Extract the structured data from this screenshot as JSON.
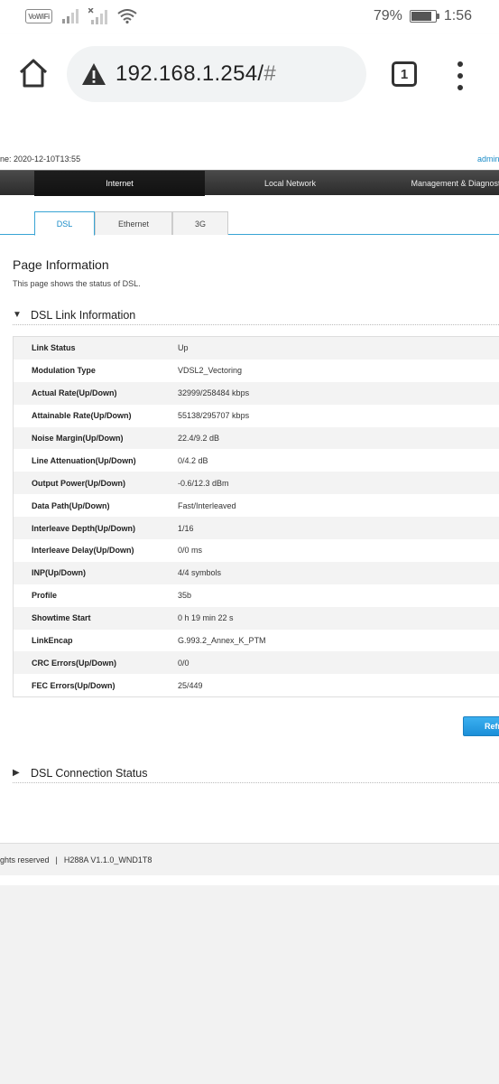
{
  "status_bar": {
    "vowifi": "VoWiFi",
    "battery_percent": "79%",
    "battery_level": 0.79,
    "time": "1:56"
  },
  "browser": {
    "url_host": "192.168.1.254/",
    "url_hash": "#",
    "tab_count": "1"
  },
  "header": {
    "time_text": "ne: 2020-12-10T13:55",
    "user_text": "admin"
  },
  "nav": {
    "items": [
      {
        "label": "Internet"
      },
      {
        "label": "Local Network"
      },
      {
        "label": "Management & Diagnostics"
      }
    ]
  },
  "subtabs": [
    {
      "label": "DSL"
    },
    {
      "label": "Ethernet"
    },
    {
      "label": "3G"
    }
  ],
  "page_info": {
    "title": "Page Information",
    "description": "This page shows the status of DSL."
  },
  "dsl_section": {
    "title": "DSL Link Information",
    "arrow": "▼",
    "rows": [
      {
        "label": "Link Status",
        "value": "Up"
      },
      {
        "label": "Modulation Type",
        "value": "VDSL2_Vectoring"
      },
      {
        "label": "Actual Rate(Up/Down)",
        "value": "32999/258484 kbps"
      },
      {
        "label": "Attainable Rate(Up/Down)",
        "value": "55138/295707 kbps"
      },
      {
        "label": "Noise Margin(Up/Down)",
        "value": "22.4/9.2 dB"
      },
      {
        "label": "Line Attenuation(Up/Down)",
        "value": "0/4.2 dB"
      },
      {
        "label": "Output Power(Up/Down)",
        "value": "-0.6/12.3 dBm"
      },
      {
        "label": "Data Path(Up/Down)",
        "value": "Fast/Interleaved"
      },
      {
        "label": "Interleave Depth(Up/Down)",
        "value": "1/16"
      },
      {
        "label": "Interleave Delay(Up/Down)",
        "value": "0/0 ms"
      },
      {
        "label": "INP(Up/Down)",
        "value": "4/4 symbols"
      },
      {
        "label": "Profile",
        "value": "35b"
      },
      {
        "label": "Showtime Start",
        "value": "0 h 19 min 22 s"
      },
      {
        "label": "LinkEncap",
        "value": "G.993.2_Annex_K_PTM"
      },
      {
        "label": "CRC Errors(Up/Down)",
        "value": "0/0"
      },
      {
        "label": "FEC Errors(Up/Down)",
        "value": "25/449"
      }
    ]
  },
  "refresh_button": "Refresh",
  "connection_section": {
    "title": "DSL Connection Status",
    "arrow": "▶"
  },
  "footer": {
    "rights": "ghts reserved",
    "separator": "|",
    "version": "H288A V1.1.0_WND1T8"
  }
}
